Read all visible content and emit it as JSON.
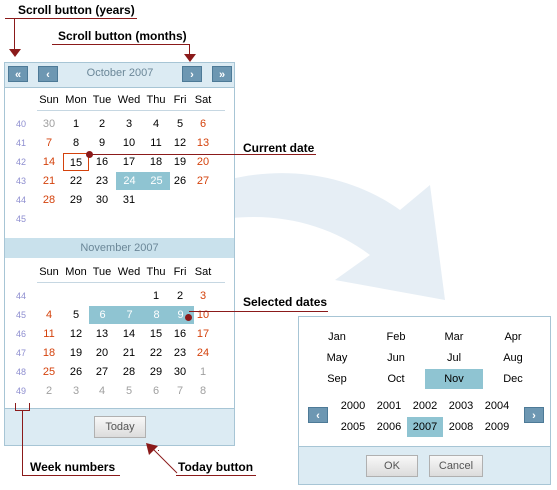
{
  "callouts": {
    "scroll_years": "Scroll button (years)",
    "scroll_months": "Scroll button (months)",
    "current_date": "Current date",
    "selected_dates": "Selected dates",
    "week_numbers": "Week numbers",
    "today_button": "Today button"
  },
  "calendar": {
    "nav": {
      "prev_year": "«",
      "prev_month": "‹",
      "next_month": "›",
      "next_year": "»"
    },
    "day_headers": [
      "Sun",
      "Mon",
      "Tue",
      "Wed",
      "Thu",
      "Fri",
      "Sat"
    ],
    "months": [
      {
        "title": "October 2007",
        "weeks": [
          {
            "wk": "40",
            "days": [
              {
                "t": "30",
                "c": "other"
              },
              {
                "t": "1"
              },
              {
                "t": "2"
              },
              {
                "t": "3"
              },
              {
                "t": "4"
              },
              {
                "t": "5"
              },
              {
                "t": "6",
                "c": "wknd"
              }
            ]
          },
          {
            "wk": "41",
            "days": [
              {
                "t": "7",
                "c": "wknd"
              },
              {
                "t": "8"
              },
              {
                "t": "9"
              },
              {
                "t": "10"
              },
              {
                "t": "11"
              },
              {
                "t": "12"
              },
              {
                "t": "13",
                "c": "wknd"
              }
            ]
          },
          {
            "wk": "42",
            "days": [
              {
                "t": "14",
                "c": "wknd"
              },
              {
                "t": "15",
                "c": "today"
              },
              {
                "t": "16"
              },
              {
                "t": "17"
              },
              {
                "t": "18"
              },
              {
                "t": "19"
              },
              {
                "t": "20",
                "c": "wknd"
              }
            ]
          },
          {
            "wk": "43",
            "days": [
              {
                "t": "21",
                "c": "wknd"
              },
              {
                "t": "22"
              },
              {
                "t": "23"
              },
              {
                "t": "24",
                "c": "sel"
              },
              {
                "t": "25",
                "c": "sel"
              },
              {
                "t": "26"
              },
              {
                "t": "27",
                "c": "wknd"
              }
            ]
          },
          {
            "wk": "44",
            "days": [
              {
                "t": "28",
                "c": "wknd"
              },
              {
                "t": "29"
              },
              {
                "t": "30"
              },
              {
                "t": "31"
              },
              {
                "t": ""
              },
              {
                "t": ""
              },
              {
                "t": ""
              }
            ]
          },
          {
            "wk": "45",
            "days": [
              {
                "t": ""
              },
              {
                "t": ""
              },
              {
                "t": ""
              },
              {
                "t": ""
              },
              {
                "t": ""
              },
              {
                "t": ""
              },
              {
                "t": ""
              }
            ]
          }
        ]
      },
      {
        "title": "November 2007",
        "weeks": [
          {
            "wk": "44",
            "days": [
              {
                "t": ""
              },
              {
                "t": ""
              },
              {
                "t": ""
              },
              {
                "t": ""
              },
              {
                "t": "1"
              },
              {
                "t": "2"
              },
              {
                "t": "3",
                "c": "wknd"
              }
            ]
          },
          {
            "wk": "45",
            "days": [
              {
                "t": "4",
                "c": "wknd"
              },
              {
                "t": "5"
              },
              {
                "t": "6",
                "c": "sel"
              },
              {
                "t": "7",
                "c": "sel"
              },
              {
                "t": "8",
                "c": "sel"
              },
              {
                "t": "9",
                "c": "sel"
              },
              {
                "t": "10",
                "c": "wknd"
              }
            ]
          },
          {
            "wk": "46",
            "days": [
              {
                "t": "11",
                "c": "wknd"
              },
              {
                "t": "12"
              },
              {
                "t": "13"
              },
              {
                "t": "14"
              },
              {
                "t": "15"
              },
              {
                "t": "16"
              },
              {
                "t": "17",
                "c": "wknd"
              }
            ]
          },
          {
            "wk": "47",
            "days": [
              {
                "t": "18",
                "c": "wknd"
              },
              {
                "t": "19"
              },
              {
                "t": "20"
              },
              {
                "t": "21"
              },
              {
                "t": "22"
              },
              {
                "t": "23"
              },
              {
                "t": "24",
                "c": "wknd"
              }
            ]
          },
          {
            "wk": "48",
            "days": [
              {
                "t": "25",
                "c": "wknd"
              },
              {
                "t": "26"
              },
              {
                "t": "27"
              },
              {
                "t": "28"
              },
              {
                "t": "29"
              },
              {
                "t": "30"
              },
              {
                "t": "1",
                "c": "other"
              }
            ]
          },
          {
            "wk": "49",
            "days": [
              {
                "t": "2",
                "c": "other"
              },
              {
                "t": "3",
                "c": "other"
              },
              {
                "t": "4",
                "c": "other"
              },
              {
                "t": "5",
                "c": "other"
              },
              {
                "t": "6",
                "c": "other"
              },
              {
                "t": "7",
                "c": "other"
              },
              {
                "t": "8",
                "c": "other"
              }
            ]
          }
        ]
      }
    ],
    "today_label": "Today"
  },
  "picker": {
    "months": [
      "Jan",
      "Feb",
      "Mar",
      "Apr",
      "May",
      "Jun",
      "Jul",
      "Aug",
      "Sep",
      "Oct",
      "Nov",
      "Dec"
    ],
    "selected_month": "Nov",
    "years": [
      "2000",
      "2001",
      "2002",
      "2003",
      "2004",
      "2005",
      "2006",
      "2007",
      "2008",
      "2009"
    ],
    "selected_year": "2007",
    "prev_label": "‹",
    "next_label": "›",
    "ok_label": "OK",
    "cancel_label": "Cancel"
  },
  "colors": {
    "accent": "#8b1a1a",
    "selection": "#8fc4d2",
    "weekend": "#d4420c",
    "week_number": "#8e8ed0"
  }
}
